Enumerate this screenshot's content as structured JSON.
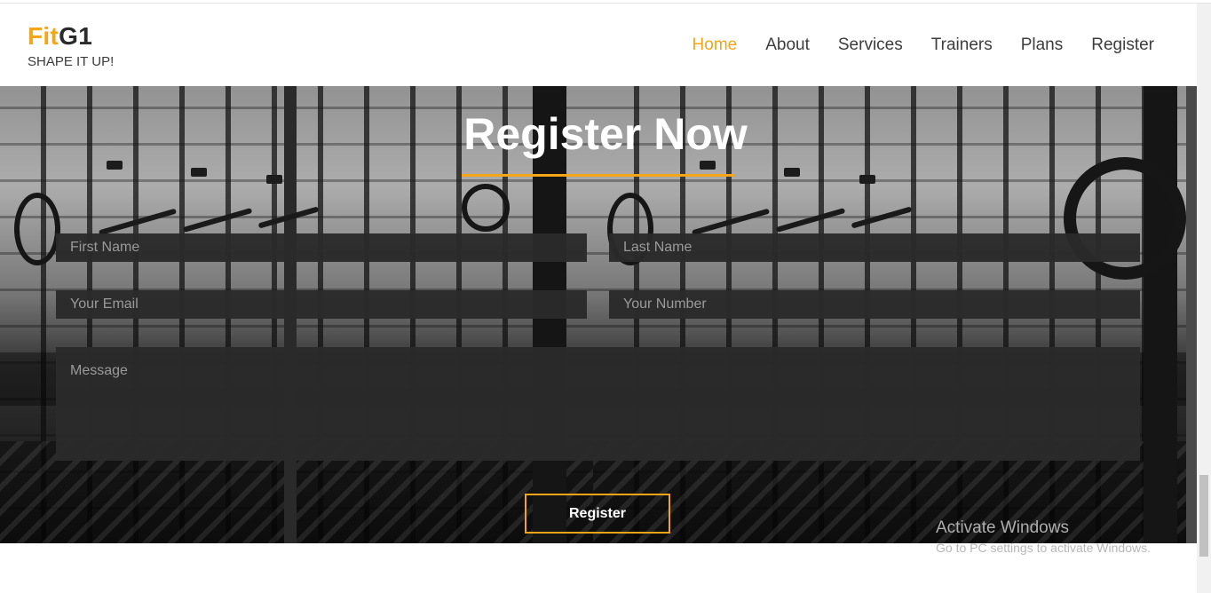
{
  "brand": {
    "logo_accent": "Fit",
    "logo_rest": "G1",
    "tagline": "SHAPE IT UP!"
  },
  "nav": {
    "items": [
      {
        "label": "Home",
        "active": true
      },
      {
        "label": "About",
        "active": false
      },
      {
        "label": "Services",
        "active": false
      },
      {
        "label": "Trainers",
        "active": false
      },
      {
        "label": "Plans",
        "active": false
      },
      {
        "label": "Register",
        "active": false
      }
    ]
  },
  "hero": {
    "title": "Register Now"
  },
  "form": {
    "first_name_placeholder": "First Name",
    "last_name_placeholder": "Last Name",
    "email_placeholder": "Your Email",
    "number_placeholder": "Your Number",
    "message_placeholder": "Message",
    "submit_label": "Register"
  },
  "watermark": {
    "title": "Activate Windows",
    "subtitle": "Go to PC settings to activate Windows."
  },
  "colors": {
    "accent": "#f5a516",
    "field_bg": "#2a2a2a",
    "text_dark": "#3d3d3d"
  }
}
